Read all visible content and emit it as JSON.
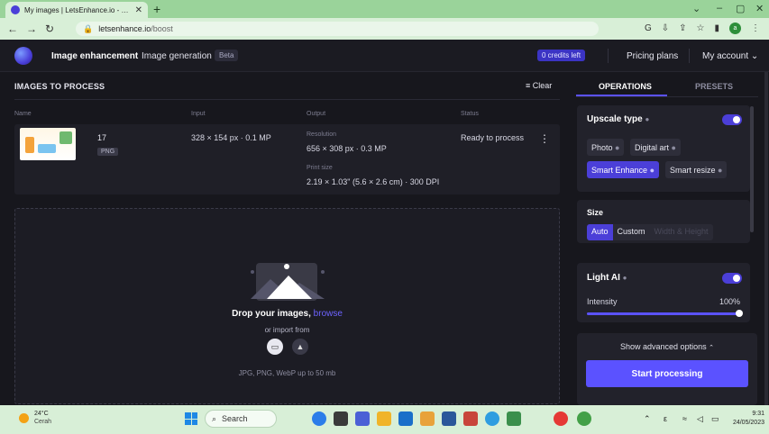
{
  "browser": {
    "tab_title": "My images | LetsEnhance.io - Ima",
    "tab_close": "✕",
    "new_tab": "+",
    "window_controls": [
      "⌄",
      "–",
      "▢",
      "✕"
    ],
    "url_domain": "letsenhance.io",
    "url_path": "/boost",
    "profile_letter": "a"
  },
  "header": {
    "nav_image_enhancement": "Image enhancement",
    "nav_image_generation": "Image generation",
    "beta_badge": "Beta",
    "credits": "0 credits left",
    "pricing": "Pricing plans",
    "account": "My account"
  },
  "images": {
    "section_title": "IMAGES TO PROCESS",
    "clear_label": "Clear",
    "columns": {
      "name": "Name",
      "input": "Input",
      "output": "Output",
      "status": "Status"
    },
    "row": {
      "name": "17",
      "type": "PNG",
      "input": "328 × 154 px · 0.1 MP",
      "resolution_label": "Resolution",
      "resolution_value": "656 × 308 px · 0.3 MP",
      "print_label": "Print size",
      "print_value": "2.19 × 1.03\" (5.6 × 2.6 cm) · 300 DPI",
      "status": "Ready to process"
    }
  },
  "dropzone": {
    "title": "Drop your images,",
    "browse": "browse",
    "import_from": "or import from",
    "formats": "JPG, PNG, WebP up to 50 mb"
  },
  "operations": {
    "tab_operations": "OPERATIONS",
    "tab_presets": "PRESETS",
    "upscale": {
      "title": "Upscale type",
      "enabled": true,
      "options": [
        "Photo",
        "Digital art",
        "Smart Enhance",
        "Smart resize"
      ],
      "selected": "Smart Enhance"
    },
    "size": {
      "title": "Size",
      "options": [
        "Auto",
        "Custom",
        "Width & Height"
      ],
      "selected": "Auto"
    },
    "light_ai": {
      "title": "Light AI",
      "enabled": true,
      "intensity_label": "Intensity",
      "intensity_value": "100%",
      "intensity_fraction": 1.0
    },
    "advanced": "Show advanced options",
    "start": "Start processing"
  },
  "taskbar": {
    "temperature": "24°C",
    "condition": "Cerah",
    "search": "Search",
    "lang": "ε",
    "time": "9:31",
    "date": "24/05/2023"
  },
  "colors": {
    "accent": "#5b52ff",
    "accent_dark": "#4b3fd8",
    "background": "#17171d",
    "browser_theme": "#d8efd7"
  }
}
